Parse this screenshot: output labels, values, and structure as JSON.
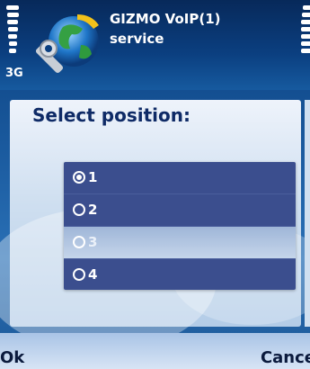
{
  "status": {
    "network": "3G",
    "signal_level": 1.0,
    "battery_level": 1.0
  },
  "app": {
    "icon": "globe-wrench-icon",
    "title_line1": "GIZMO VoIP(1)",
    "title_line2": "service"
  },
  "dialog": {
    "heading": "Select position:",
    "options": [
      {
        "label": "1",
        "checked": true
      },
      {
        "label": "2",
        "checked": false
      },
      {
        "label": "3",
        "checked": false
      },
      {
        "label": "4",
        "checked": false
      }
    ]
  },
  "softkeys": {
    "left": "Ok",
    "right": "Cance"
  },
  "colors": {
    "accent": "#0b3f80",
    "list_bg": "#3b4e8e",
    "highlight": "#b3c8e4"
  }
}
